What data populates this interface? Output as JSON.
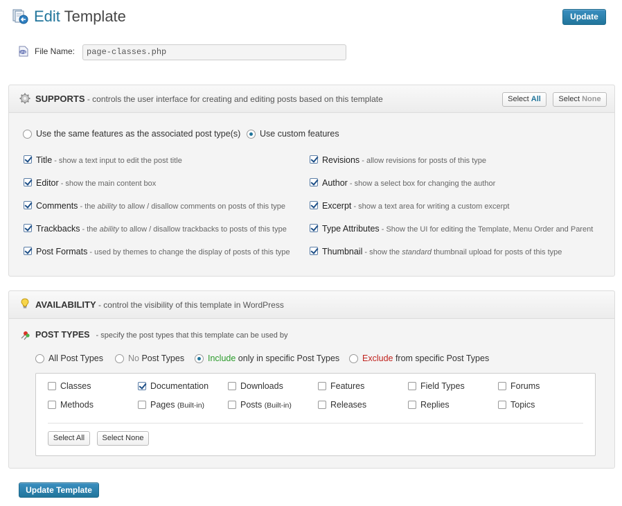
{
  "header": {
    "title_accent": "Edit",
    "title_rest": " Template",
    "update_label": "Update"
  },
  "file": {
    "label": "File Name:",
    "value": "page-classes.php"
  },
  "supports": {
    "title": "SUPPORTS",
    "desc": " - controls the user interface for creating and editing posts based on this template",
    "select_all_prefix": "Select ",
    "select_all_em": "All",
    "select_none_prefix": "Select ",
    "select_none_em": "None",
    "radio_same": "Use the same features as the associated post type(s)",
    "radio_custom": "Use custom features",
    "features": [
      {
        "name": "Title",
        "desc": " - show a text input to edit the post title"
      },
      {
        "name": "Editor",
        "desc": " - show the main content box"
      },
      {
        "name": "Comments",
        "desc_a": " - the ",
        "desc_em": "ability",
        "desc_b": " to allow / disallow comments on posts of this type"
      },
      {
        "name": "Trackbacks",
        "desc_a": " - the ",
        "desc_em": "ability",
        "desc_b": " to allow / disallow trackbacks to posts of this type"
      },
      {
        "name": "Post Formats",
        "desc": " - used by themes to change the display of posts of this type"
      },
      {
        "name": "Revisions",
        "desc": " - allow revisions for posts of this type"
      },
      {
        "name": "Author",
        "desc": " - show a select box for changing the author"
      },
      {
        "name": "Excerpt",
        "desc": " - show a text area for writing a custom excerpt"
      },
      {
        "name": "Type Attributes",
        "desc": " - Show the UI for editing the Template, Menu Order and Parent"
      },
      {
        "name": "Thumbnail",
        "desc_a": " - show the ",
        "desc_em": "standard",
        "desc_b": " thumbnail upload for posts of this type"
      }
    ]
  },
  "availability": {
    "title": "AVAILABILITY",
    "desc": " - control the visibility of this template in WordPress",
    "post_types_title": "POST TYPES",
    "post_types_desc": "-  specify the post types that this template can be used by",
    "opt_all_a": "All",
    "opt_all_b": " Post Types",
    "opt_no_a": "No",
    "opt_no_b": " Post Types",
    "opt_include_a": "Include",
    "opt_include_b": " only in specific Post Types",
    "opt_exclude_a": "Exclude",
    "opt_exclude_b": " from specific Post Types",
    "types": [
      {
        "label": "Classes",
        "checked": false
      },
      {
        "label": "Documentation",
        "checked": true
      },
      {
        "label": "Downloads",
        "checked": false
      },
      {
        "label": "Features",
        "checked": false
      },
      {
        "label": "Field Types",
        "checked": false
      },
      {
        "label": "Forums",
        "checked": false
      },
      {
        "label": "Methods",
        "checked": false
      },
      {
        "label": "Pages",
        "suffix": "(Built-in)",
        "checked": false
      },
      {
        "label": "Posts",
        "suffix": "(Built-in)",
        "checked": false
      },
      {
        "label": "Releases",
        "checked": false
      },
      {
        "label": "Replies",
        "checked": false
      },
      {
        "label": "Topics",
        "checked": false
      }
    ],
    "select_all": "Select All",
    "select_none": "Select None"
  },
  "footer": {
    "update_template_label": "Update Template"
  },
  "colors": {
    "accent": "#21759b",
    "include": "#2a9a2a",
    "exclude": "#c0231e"
  }
}
